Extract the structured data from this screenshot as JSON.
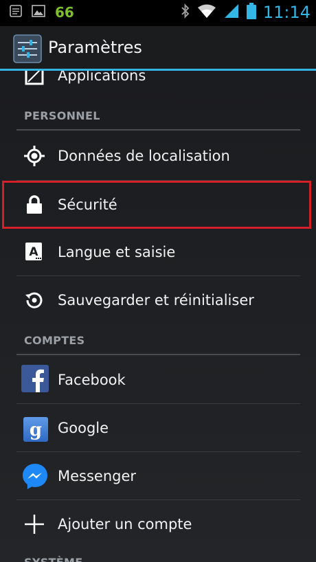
{
  "status_bar": {
    "badge": "66",
    "time": "11:14",
    "icons": [
      "notification-icon",
      "image-icon",
      "bluetooth-icon",
      "wifi-icon",
      "signal-icon",
      "battery-icon"
    ]
  },
  "action_bar": {
    "title": "Paramètres",
    "icon": "settings-app-icon"
  },
  "colors": {
    "accent": "#33b5e5",
    "highlight": "#d32028",
    "facebook": "#3b5998",
    "google": "#3a7bd5",
    "messenger": "#1e88f5"
  },
  "list": {
    "partial_top_item": "Applications",
    "sections": [
      {
        "header": "PERSONNEL",
        "items": [
          {
            "label": "Données de localisation",
            "icon": "location-icon"
          },
          {
            "label": "Sécurité",
            "icon": "lock-icon",
            "highlighted": true
          },
          {
            "label": "Langue et saisie",
            "icon": "keyboard-language-icon"
          },
          {
            "label": "Sauvegarder et réinitialiser",
            "icon": "backup-restore-icon"
          }
        ]
      },
      {
        "header": "COMPTES",
        "items": [
          {
            "label": "Facebook",
            "icon": "facebook-icon"
          },
          {
            "label": "Google",
            "icon": "google-icon"
          },
          {
            "label": "Messenger",
            "icon": "messenger-icon"
          },
          {
            "label": "Ajouter un compte",
            "icon": "plus-icon"
          }
        ]
      },
      {
        "header": "SYSTÈME",
        "items": []
      }
    ]
  }
}
